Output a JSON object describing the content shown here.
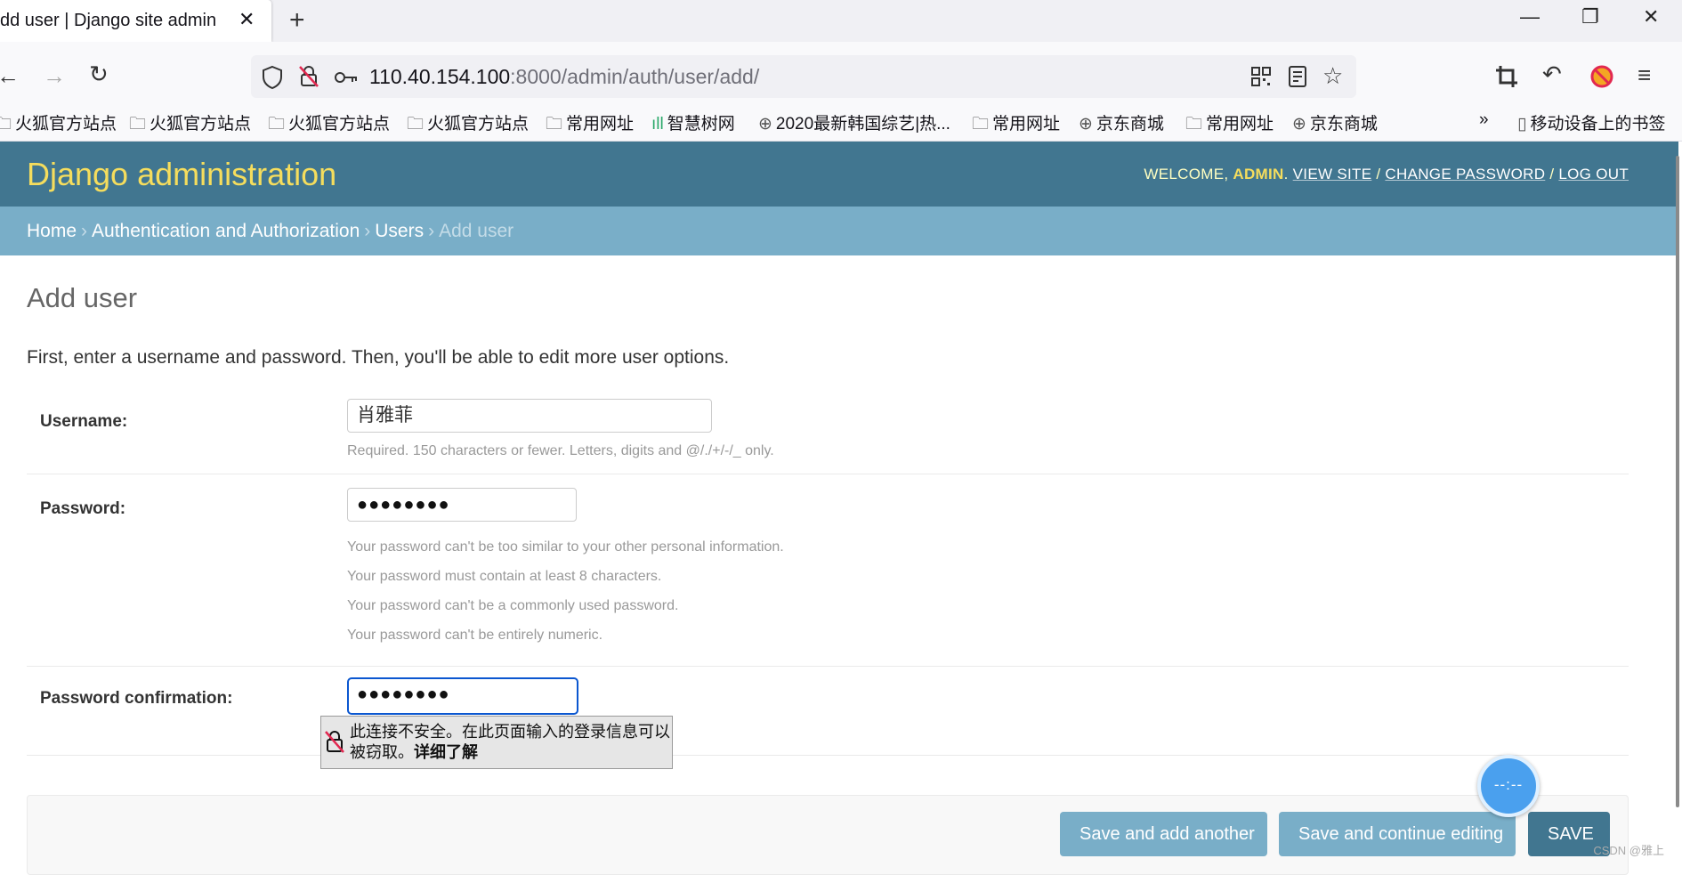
{
  "browser": {
    "tab_title": "dd user | Django site admin",
    "tab_close": "✕",
    "new_tab": "+",
    "url_host": "110.40.154.100",
    "url_rest": ":8000/admin/auth/user/add/",
    "window_minimize": "—",
    "window_restore": "❐",
    "window_close": "✕"
  },
  "bookmarks": [
    "火狐官方站点",
    "火狐官方站点",
    "火狐官方站点",
    "火狐官方站点",
    "常用网址",
    "智慧树网",
    "2020最新韩国综艺|热...",
    "常用网址",
    "京东商城",
    "常用网址",
    "京东商城"
  ],
  "bookmarks_mobile": "移动设备上的书签",
  "admin": {
    "brand": "Django administration",
    "welcome": "WELCOME, ",
    "username": "ADMIN",
    "view_site": "VIEW SITE",
    "change_password": "CHANGE PASSWORD",
    "log_out": "LOG OUT",
    "slash": "/"
  },
  "breadcrumbs": {
    "home": "Home",
    "auth": "Authentication and Authorization",
    "users": "Users",
    "current": "Add user",
    "sep": "›"
  },
  "page": {
    "title": "Add user",
    "intro": "First, enter a username and password. Then, you'll be able to edit more user options."
  },
  "form": {
    "username_label": "Username:",
    "username_value": "肖雅菲",
    "username_help": "Required. 150 characters or fewer. Letters, digits and @/./+/-/_ only.",
    "password_label": "Password:",
    "password_value": "●●●●●●●●",
    "password_help": [
      "Your password can't be too similar to your other personal information.",
      "Your password must contain at least 8 characters.",
      "Your password can't be a commonly used password.",
      "Your password can't be entirely numeric."
    ],
    "confirm_label": "Password confirmation:",
    "confirm_value": "●●●●●●●●"
  },
  "insecure_warning": {
    "text": "此连接不安全。在此页面输入的登录信息可以被窃取。",
    "link": "详细了解"
  },
  "buttons": {
    "save_add_another": "Save and add another",
    "save_continue": "Save and continue editing",
    "save": "SAVE"
  },
  "float_button_label": "--:--",
  "watermark": "CSDN @雅上",
  "colors": {
    "header": "#417690",
    "brand": "#f5dd5d",
    "breadcrumbs": "#79aec8",
    "button": "#79aec8",
    "button_default": "#417690"
  }
}
